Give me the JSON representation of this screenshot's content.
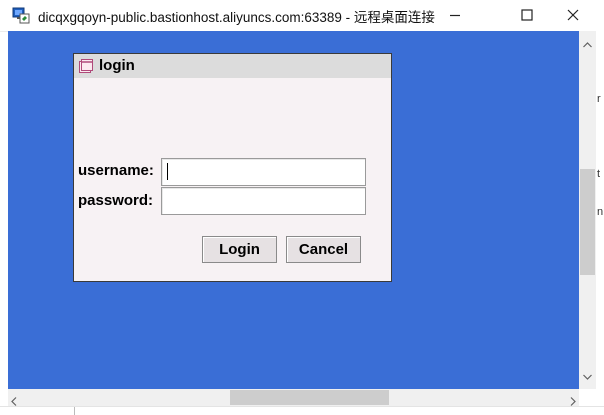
{
  "window": {
    "title": "dicqxgqoyn-public.bastionhost.aliyuncs.com:63389 - 远程桌面连接",
    "app_icon": "remote-desktop-icon",
    "controls": {
      "minimize_icon": "minimize-icon",
      "maximize_icon": "maximize-icon",
      "close_icon": "close-icon"
    }
  },
  "colors": {
    "desktop_background": "#3a6ed6",
    "dialog_background": "#f7f2f4",
    "dialog_titlebar": "#dcdcdc"
  },
  "login_dialog": {
    "title": "login",
    "icon": "window-icon",
    "username_label": "username:",
    "username_value": "",
    "password_label": "password:",
    "password_value": "",
    "login_button": "Login",
    "cancel_button": "Cancel"
  },
  "background_peek": {
    "line1": "r",
    "line2": "t",
    "line3": "n"
  }
}
